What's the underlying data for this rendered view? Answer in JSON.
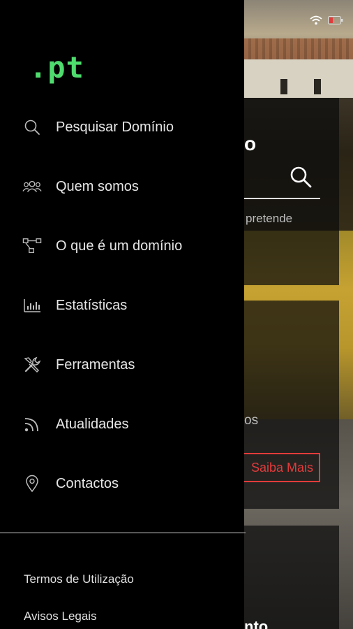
{
  "background": {
    "heading_fragment": "o",
    "search_hint_fragment": "pretende",
    "promo_text_fragment": "os",
    "promo_button_label": "Saiba Mais",
    "bottom_text_fragment": "nto",
    "accent_color": "#e23b3b"
  },
  "drawer": {
    "logo_text": ".pt",
    "logo_color": "#4fdc6e",
    "menu": [
      {
        "label": "Pesquisar Domínio",
        "icon": "search-icon"
      },
      {
        "label": "Quem somos",
        "icon": "group-icon"
      },
      {
        "label": "O que é um domínio",
        "icon": "network-icon"
      },
      {
        "label": "Estatísticas",
        "icon": "bar-chart-icon"
      },
      {
        "label": "Ferramentas",
        "icon": "tools-icon"
      },
      {
        "label": "Atualidades",
        "icon": "rss-icon"
      },
      {
        "label": "Contactos",
        "icon": "location-pin-icon"
      }
    ],
    "footer": [
      {
        "label": "Termos de Utilização"
      },
      {
        "label": "Avisos Legais"
      }
    ]
  }
}
